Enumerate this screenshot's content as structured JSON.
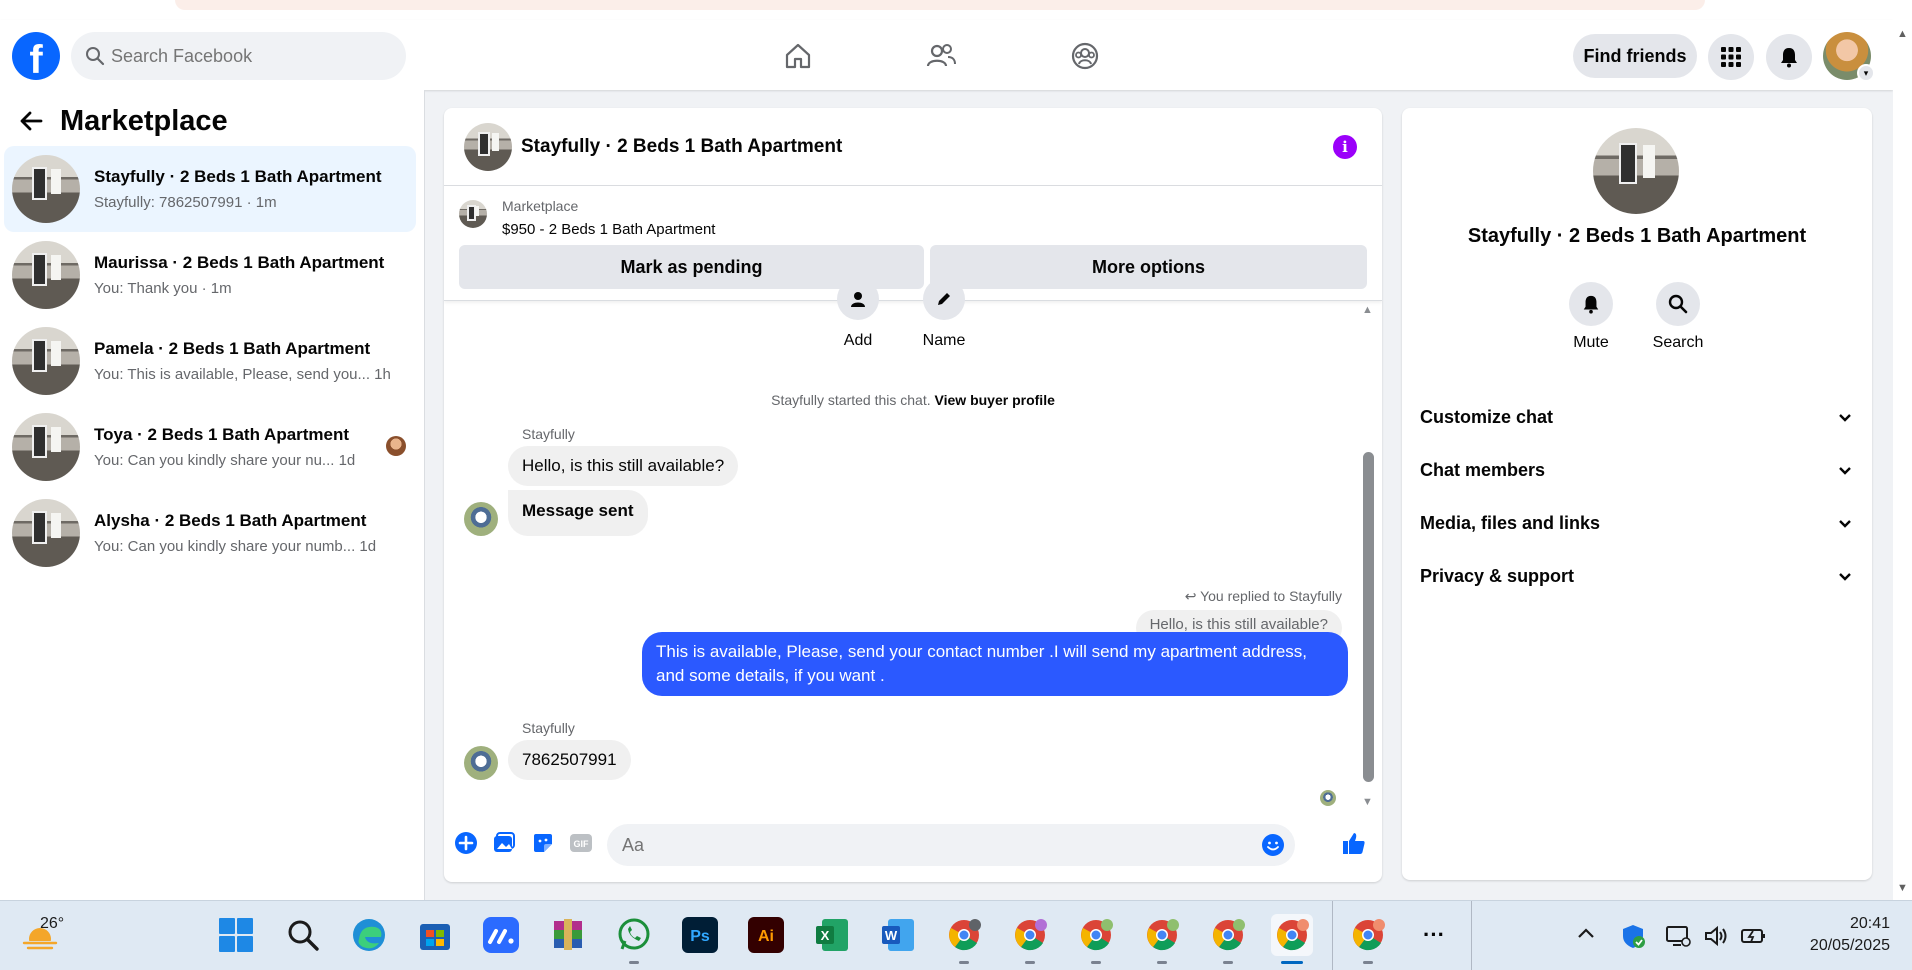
{
  "topnav": {
    "search_placeholder": "Search Facebook",
    "find_friends": "Find friends",
    "logo": "f"
  },
  "sidebar": {
    "title": "Marketplace",
    "conversations": [
      {
        "name": "Stayfully · 2 Beds 1 Bath Apartment",
        "preview": "Stayfully: 7862507991 · 1m",
        "active": true
      },
      {
        "name": "Maurissa · 2 Beds 1 Bath Apartment",
        "preview": "You: Thank you · 1m"
      },
      {
        "name": "Pamela · 2 Beds 1 Bath Apartment",
        "preview": "You: This is available, Please, send you...  1h"
      },
      {
        "name": "Toya · 2 Beds 1 Bath Apartment",
        "preview": "You: Can you kindly share your nu...  1d"
      },
      {
        "name": "Alysha · 2 Beds 1 Bath Apartment",
        "preview": "You: Can you kindly share your numb...  1d"
      }
    ]
  },
  "chat": {
    "title": "Stayfully · 2 Beds 1 Bath Apartment",
    "info_icon": "i",
    "listing": {
      "label": "Marketplace",
      "price_title": "$950 - 2 Beds 1 Bath Apartment",
      "mark_pending": "Mark as pending",
      "more_options": "More options"
    },
    "actions": {
      "add": "Add",
      "name": "Name"
    },
    "system_note": "Stayfully started this chat.",
    "view_profile": "View buyer profile",
    "messages": {
      "sender1": "Stayfully",
      "m1": "Hello, is this still available?",
      "m2": "Message sent",
      "replied_label": "You replied to Stayfully",
      "quoted": "Hello, is this still available?",
      "out": "This is  available, Please, send your contact number .I will send my apartment address, and some details, if you want .",
      "sender2": "Stayfully",
      "m3": "7862507991"
    },
    "composer_placeholder": "Aa"
  },
  "info_panel": {
    "title": "Stayfully · 2 Beds 1 Bath Apartment",
    "mute": "Mute",
    "search": "Search",
    "sections": [
      "Customize chat",
      "Chat members",
      "Media, files and links",
      "Privacy & support"
    ]
  },
  "taskbar": {
    "temperature": "26°",
    "time": "20:41",
    "date": "20/05/2025",
    "overflow": "···",
    "apps": [
      "windows-start",
      "search",
      "edge",
      "microsoft-store",
      "monday",
      "winrar",
      "whatsapp",
      "photoshop",
      "illustrator",
      "excel",
      "word",
      "chrome",
      "chrome",
      "chrome",
      "chrome",
      "chrome",
      "chrome",
      "chrome"
    ]
  },
  "colors": {
    "facebook_blue": "#0866ff",
    "outgoing_bubble": "#2b59ff",
    "active_conversation": "#ebf5ff",
    "info_purple": "#9b00fa"
  }
}
